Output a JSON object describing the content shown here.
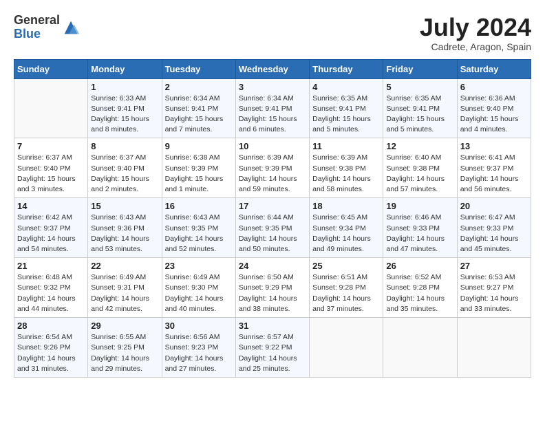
{
  "header": {
    "logo_general": "General",
    "logo_blue": "Blue",
    "month_title": "July 2024",
    "location": "Cadrete, Aragon, Spain"
  },
  "days_of_week": [
    "Sunday",
    "Monday",
    "Tuesday",
    "Wednesday",
    "Thursday",
    "Friday",
    "Saturday"
  ],
  "weeks": [
    [
      {
        "day": "",
        "text": ""
      },
      {
        "day": "1",
        "text": "Sunrise: 6:33 AM\nSunset: 9:41 PM\nDaylight: 15 hours\nand 8 minutes."
      },
      {
        "day": "2",
        "text": "Sunrise: 6:34 AM\nSunset: 9:41 PM\nDaylight: 15 hours\nand 7 minutes."
      },
      {
        "day": "3",
        "text": "Sunrise: 6:34 AM\nSunset: 9:41 PM\nDaylight: 15 hours\nand 6 minutes."
      },
      {
        "day": "4",
        "text": "Sunrise: 6:35 AM\nSunset: 9:41 PM\nDaylight: 15 hours\nand 5 minutes."
      },
      {
        "day": "5",
        "text": "Sunrise: 6:35 AM\nSunset: 9:41 PM\nDaylight: 15 hours\nand 5 minutes."
      },
      {
        "day": "6",
        "text": "Sunrise: 6:36 AM\nSunset: 9:40 PM\nDaylight: 15 hours\nand 4 minutes."
      }
    ],
    [
      {
        "day": "7",
        "text": "Sunrise: 6:37 AM\nSunset: 9:40 PM\nDaylight: 15 hours\nand 3 minutes."
      },
      {
        "day": "8",
        "text": "Sunrise: 6:37 AM\nSunset: 9:40 PM\nDaylight: 15 hours\nand 2 minutes."
      },
      {
        "day": "9",
        "text": "Sunrise: 6:38 AM\nSunset: 9:39 PM\nDaylight: 15 hours\nand 1 minute."
      },
      {
        "day": "10",
        "text": "Sunrise: 6:39 AM\nSunset: 9:39 PM\nDaylight: 14 hours\nand 59 minutes."
      },
      {
        "day": "11",
        "text": "Sunrise: 6:39 AM\nSunset: 9:38 PM\nDaylight: 14 hours\nand 58 minutes."
      },
      {
        "day": "12",
        "text": "Sunrise: 6:40 AM\nSunset: 9:38 PM\nDaylight: 14 hours\nand 57 minutes."
      },
      {
        "day": "13",
        "text": "Sunrise: 6:41 AM\nSunset: 9:37 PM\nDaylight: 14 hours\nand 56 minutes."
      }
    ],
    [
      {
        "day": "14",
        "text": "Sunrise: 6:42 AM\nSunset: 9:37 PM\nDaylight: 14 hours\nand 54 minutes."
      },
      {
        "day": "15",
        "text": "Sunrise: 6:43 AM\nSunset: 9:36 PM\nDaylight: 14 hours\nand 53 minutes."
      },
      {
        "day": "16",
        "text": "Sunrise: 6:43 AM\nSunset: 9:35 PM\nDaylight: 14 hours\nand 52 minutes."
      },
      {
        "day": "17",
        "text": "Sunrise: 6:44 AM\nSunset: 9:35 PM\nDaylight: 14 hours\nand 50 minutes."
      },
      {
        "day": "18",
        "text": "Sunrise: 6:45 AM\nSunset: 9:34 PM\nDaylight: 14 hours\nand 49 minutes."
      },
      {
        "day": "19",
        "text": "Sunrise: 6:46 AM\nSunset: 9:33 PM\nDaylight: 14 hours\nand 47 minutes."
      },
      {
        "day": "20",
        "text": "Sunrise: 6:47 AM\nSunset: 9:33 PM\nDaylight: 14 hours\nand 45 minutes."
      }
    ],
    [
      {
        "day": "21",
        "text": "Sunrise: 6:48 AM\nSunset: 9:32 PM\nDaylight: 14 hours\nand 44 minutes."
      },
      {
        "day": "22",
        "text": "Sunrise: 6:49 AM\nSunset: 9:31 PM\nDaylight: 14 hours\nand 42 minutes."
      },
      {
        "day": "23",
        "text": "Sunrise: 6:49 AM\nSunset: 9:30 PM\nDaylight: 14 hours\nand 40 minutes."
      },
      {
        "day": "24",
        "text": "Sunrise: 6:50 AM\nSunset: 9:29 PM\nDaylight: 14 hours\nand 38 minutes."
      },
      {
        "day": "25",
        "text": "Sunrise: 6:51 AM\nSunset: 9:28 PM\nDaylight: 14 hours\nand 37 minutes."
      },
      {
        "day": "26",
        "text": "Sunrise: 6:52 AM\nSunset: 9:28 PM\nDaylight: 14 hours\nand 35 minutes."
      },
      {
        "day": "27",
        "text": "Sunrise: 6:53 AM\nSunset: 9:27 PM\nDaylight: 14 hours\nand 33 minutes."
      }
    ],
    [
      {
        "day": "28",
        "text": "Sunrise: 6:54 AM\nSunset: 9:26 PM\nDaylight: 14 hours\nand 31 minutes."
      },
      {
        "day": "29",
        "text": "Sunrise: 6:55 AM\nSunset: 9:25 PM\nDaylight: 14 hours\nand 29 minutes."
      },
      {
        "day": "30",
        "text": "Sunrise: 6:56 AM\nSunset: 9:23 PM\nDaylight: 14 hours\nand 27 minutes."
      },
      {
        "day": "31",
        "text": "Sunrise: 6:57 AM\nSunset: 9:22 PM\nDaylight: 14 hours\nand 25 minutes."
      },
      {
        "day": "",
        "text": ""
      },
      {
        "day": "",
        "text": ""
      },
      {
        "day": "",
        "text": ""
      }
    ]
  ]
}
